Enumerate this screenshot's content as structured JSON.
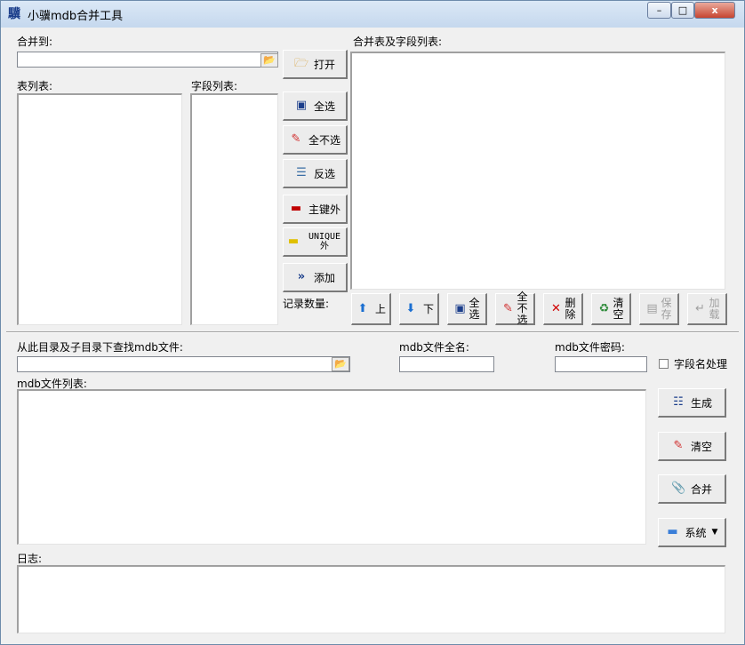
{
  "window": {
    "title": "小骥mdb合并工具",
    "icon": "app-logo-icon"
  },
  "titlebar_buttons": {
    "minimize": "–",
    "maximize": "□",
    "close": "x"
  },
  "top": {
    "merge_to_label": "合并到:",
    "merge_to_value": "",
    "table_list_label": "表列表:",
    "field_list_label": "字段列表:",
    "merged_list_label": "合并表及字段列表:",
    "record_count_label": "记录数量:"
  },
  "mid_buttons": {
    "open": "打开",
    "select_all": "全选",
    "select_none": "全不选",
    "invert": "反选",
    "pk_out": "主键外",
    "unique_out": "UNIQUE外",
    "add": "添加"
  },
  "bottom_toolbar": {
    "up": "上",
    "down": "下",
    "select_all": "全选",
    "select_none": "全不选",
    "delete": "删除",
    "clear": "清空",
    "save": "保存",
    "load": "加载"
  },
  "lower": {
    "search_label": "从此目录及子目录下查找mdb文件:",
    "search_value": "",
    "fullname_label": "mdb文件全名:",
    "fullname_value": "",
    "password_label": "mdb文件密码:",
    "password_value": "",
    "fieldname_check_label": "字段名处理",
    "file_list_label": "mdb文件列表:",
    "log_label": "日志:"
  },
  "right_buttons": {
    "generate": "生成",
    "clear": "清空",
    "merge": "合并",
    "system": "系统"
  },
  "colors": {
    "window_bg": "#f0f0f0",
    "border": "#828790",
    "accent": "#1b3e8b",
    "close": "#c74631"
  }
}
